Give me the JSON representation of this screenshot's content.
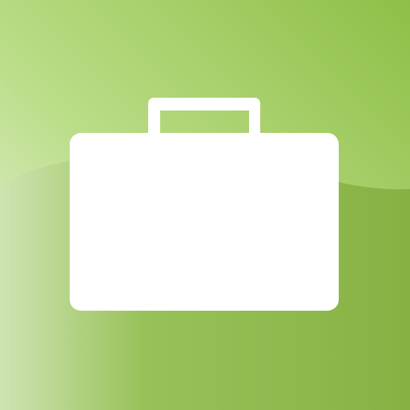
{
  "app_icon": {
    "icon": "briefcase-icon",
    "colors": {
      "background_light": "#eef6e2",
      "background_mid": "#b9dc86",
      "background_dark": "#8fbf47",
      "lower_band_light": "#cfe3b2",
      "lower_band_dark": "#86b244",
      "icon_fill": "#ffffff"
    }
  }
}
